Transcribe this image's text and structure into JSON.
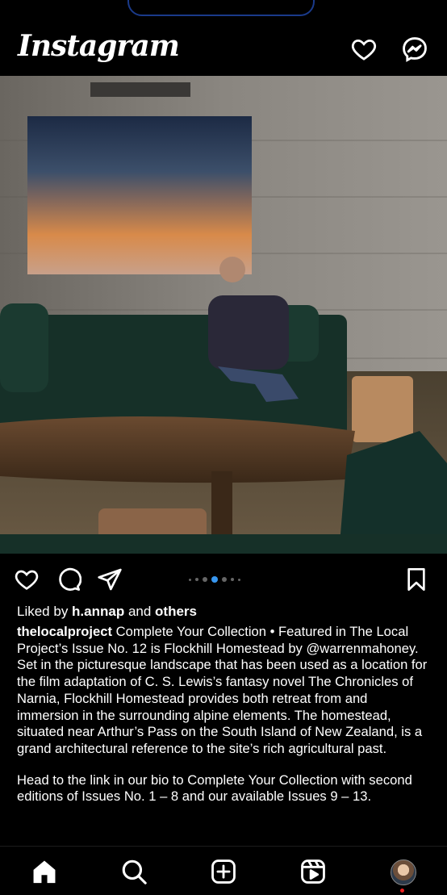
{
  "header": {
    "logo": "Instagram",
    "icons": [
      "heart-icon",
      "messenger-icon"
    ]
  },
  "post": {
    "carousel": {
      "total": 7,
      "current": 3
    },
    "liked_by_prefix": "Liked by ",
    "liked_by_user": "h.annap",
    "liked_by_and": " and ",
    "liked_by_others": "others",
    "username": "thelocalproject",
    "caption_p1": " Complete Your Collection • Featured in The Local Project’s Issue No. 12 is Flockhill Homestead by @warrenmahoney. Set in the picturesque landscape that has been used as a location for the film adaptation of C. S. Lewis’s fantasy novel The Chronicles of Narnia, Flockhill Homestead provides both retreat from and immersion in the surrounding alpine elements. The homestead, situated near Arthur’s Pass on the South Island of New Zealand, is a grand architectural reference to the site’s rich agricultural past.",
    "caption_p2": "Head to the link in our bio to Complete Your Collection with second editions of Issues No. 1 – 8 and our available Issues 9 – 13."
  },
  "tab_bar": {
    "tabs": [
      "home-icon",
      "search-icon",
      "create-post-icon",
      "reels-icon",
      "profile-avatar"
    ]
  },
  "colors": {
    "background": "#000000",
    "text": "#ffffff",
    "carousel_active": "#3897f0",
    "notification_dot": "#e22222"
  }
}
